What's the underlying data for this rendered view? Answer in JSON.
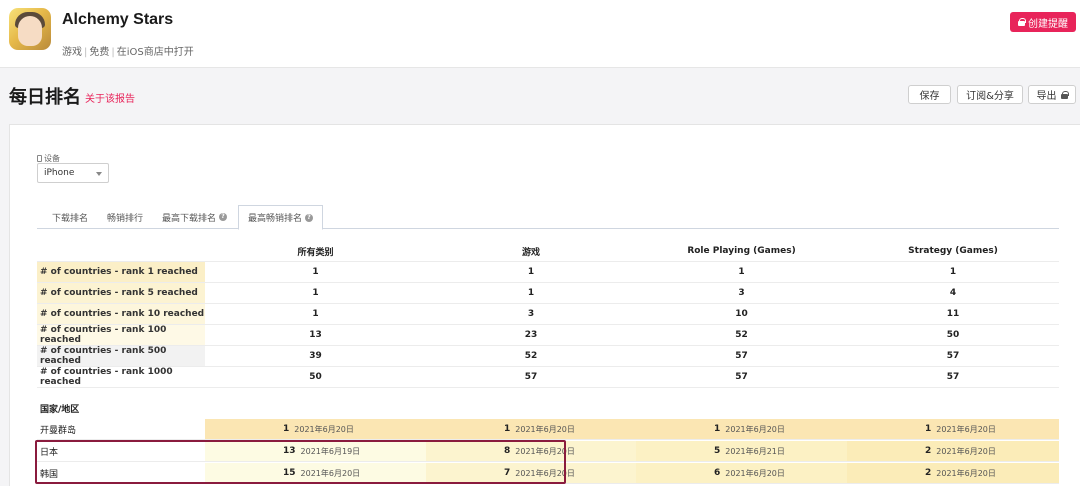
{
  "app": {
    "title": "Alchemy Stars",
    "meta": [
      "游戏",
      "免费",
      "在iOS商店中打开"
    ]
  },
  "header": {
    "create_alert_label": "创建提醒"
  },
  "page": {
    "title": "每日排名",
    "about_label": "关于该报告"
  },
  "toolbar": {
    "save_label": "保存",
    "subscribe_label": "订阅&分享",
    "export_label": "导出"
  },
  "device": {
    "label": "设备",
    "value": "iPhone"
  },
  "tabs": [
    {
      "label": "下载排名",
      "help": false,
      "active": false
    },
    {
      "label": "畅销排行",
      "help": false,
      "active": false
    },
    {
      "label": "最高下载排名",
      "help": true,
      "active": false
    },
    {
      "label": "最高畅销排名",
      "help": true,
      "active": true
    }
  ],
  "table": {
    "columns": [
      "所有类别",
      "游戏",
      "Role Playing (Games)",
      "Strategy (Games)"
    ],
    "summary_rows": [
      {
        "label": "# of countries - rank 1 reached",
        "values": [
          "1",
          "1",
          "1",
          "1"
        ],
        "tint": "#fbefc7"
      },
      {
        "label": "# of countries - rank 5 reached",
        "values": [
          "1",
          "1",
          "3",
          "4"
        ],
        "tint": "#fcf3d2"
      },
      {
        "label": "# of countries - rank 10 reached",
        "values": [
          "1",
          "3",
          "10",
          "11"
        ],
        "tint": "#fdf6dc"
      },
      {
        "label": "# of countries - rank 100 reached",
        "values": [
          "13",
          "23",
          "52",
          "50"
        ],
        "tint": "#fef9e6"
      },
      {
        "label": "# of countries - rank 500 reached",
        "values": [
          "39",
          "52",
          "57",
          "57"
        ],
        "tint": "#f2f2f2"
      },
      {
        "label": "# of countries - rank 1000 reached",
        "values": [
          "50",
          "57",
          "57",
          "57"
        ],
        "tint": "#ffffff"
      }
    ],
    "country_header": "国家/地区",
    "country_rows": [
      {
        "country": "开曼群岛",
        "cells": [
          {
            "rank": "1",
            "date": "2021年6月20日",
            "tint": "#fbe6b3"
          },
          {
            "rank": "1",
            "date": "2021年6月20日",
            "tint": "#fbe6b3"
          },
          {
            "rank": "1",
            "date": "2021年6月20日",
            "tint": "#fbe6b3"
          },
          {
            "rank": "1",
            "date": "2021年6月20日",
            "tint": "#fbe6b3"
          }
        ]
      },
      {
        "country": "日本",
        "cells": [
          {
            "rank": "13",
            "date": "2021年6月19日",
            "tint": "#fdfbe3"
          },
          {
            "rank": "8",
            "date": "2021年6月20日",
            "tint": "#fcf4cf"
          },
          {
            "rank": "5",
            "date": "2021年6月21日",
            "tint": "#fcf1c4"
          },
          {
            "rank": "2",
            "date": "2021年6月20日",
            "tint": "#fbecb8"
          }
        ]
      },
      {
        "country": "韩国",
        "cells": [
          {
            "rank": "15",
            "date": "2021年6月20日",
            "tint": "#fdfbe3"
          },
          {
            "rank": "7",
            "date": "2021年6月20日",
            "tint": "#fcf4cf"
          },
          {
            "rank": "6",
            "date": "2021年6月20日",
            "tint": "#fcf1c4"
          },
          {
            "rank": "2",
            "date": "2021年6月20日",
            "tint": "#fbecb8"
          }
        ]
      }
    ]
  },
  "colors": {
    "accent": "#e8245a",
    "highlight_border": "#8a1b3e"
  }
}
